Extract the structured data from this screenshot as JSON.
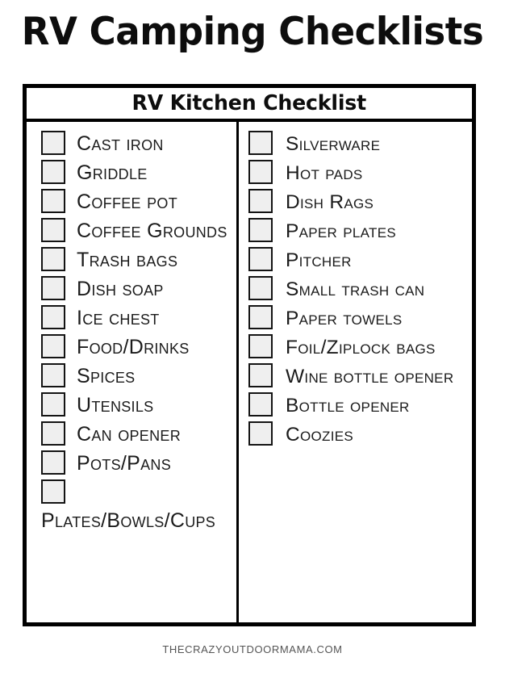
{
  "page": {
    "title": "RV Camping Checklists",
    "footer": "THECRAZYOUTDOORMAMA.COM"
  },
  "checklist": {
    "header_title": "RV Kitchen Checklist",
    "columns": [
      {
        "name": "left-column",
        "items": [
          {
            "label": "Cast iron",
            "checked": false
          },
          {
            "label": "Griddle",
            "checked": false
          },
          {
            "label": "Coffee pot",
            "checked": false
          },
          {
            "label": "Coffee Grounds",
            "checked": false
          },
          {
            "label": "Trash bags",
            "checked": false
          },
          {
            "label": "Dish soap",
            "checked": false
          },
          {
            "label": "Ice chest",
            "checked": false
          },
          {
            "label": "Food/Drinks",
            "checked": false
          },
          {
            "label": "Spices",
            "checked": false
          },
          {
            "label": "Utensils",
            "checked": false
          },
          {
            "label": "Can opener",
            "checked": false
          },
          {
            "label": "Pots/Pans",
            "checked": false
          },
          {
            "label": "Plates/Bowls/Cups",
            "checked": false
          }
        ]
      },
      {
        "name": "right-column",
        "items": [
          {
            "label": "Silverware",
            "checked": false
          },
          {
            "label": "Hot pads",
            "checked": false
          },
          {
            "label": "Dish Rags",
            "checked": false
          },
          {
            "label": "Paper plates",
            "checked": false
          },
          {
            "label": "Pitcher",
            "checked": false
          },
          {
            "label": "Small trash can",
            "checked": false
          },
          {
            "label": "Paper towels",
            "checked": false
          },
          {
            "label": "Foil/Ziplock bags",
            "checked": false
          },
          {
            "label": "Wine bottle opener",
            "checked": false
          },
          {
            "label": "Bottle opener",
            "checked": false
          },
          {
            "label": "Coozies",
            "checked": false
          }
        ]
      }
    ]
  },
  "style": {
    "ink": "#0d0d0d",
    "checkbox_fill": "#efefef",
    "checkbox_border": "#141414",
    "footer_color": "#555555"
  }
}
